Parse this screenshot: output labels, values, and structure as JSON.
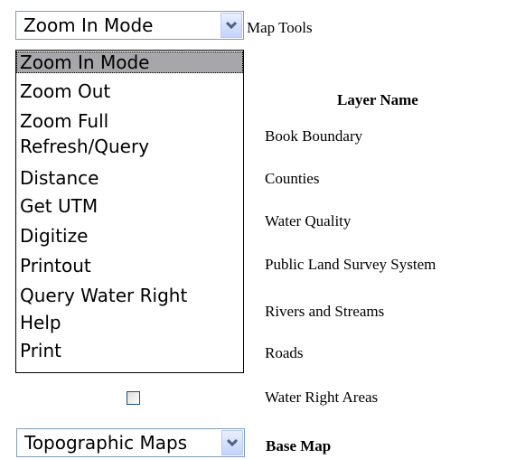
{
  "tool_select": {
    "selected": "Zoom In Mode",
    "label": "Map Tools",
    "options": [
      "Zoom In Mode",
      "Zoom Out",
      "Zoom Full",
      "Refresh/Query",
      "Distance",
      "Get UTM",
      "Digitize",
      "Printout",
      "Query Water Right",
      "Help",
      "Print"
    ]
  },
  "layers": {
    "header": "Layer Name",
    "items": [
      "Book Boundary",
      "Counties",
      "Water Quality",
      "Public Land Survey System",
      "Rivers and Streams",
      "Roads",
      "Water Right Areas"
    ]
  },
  "base_map": {
    "selected": "Topographic Maps",
    "label": "Base Map"
  },
  "colors": {
    "list_highlight": "#a7a6aa",
    "select_border": "#7f9db9",
    "arrow_bg": "#c3d3fd"
  }
}
